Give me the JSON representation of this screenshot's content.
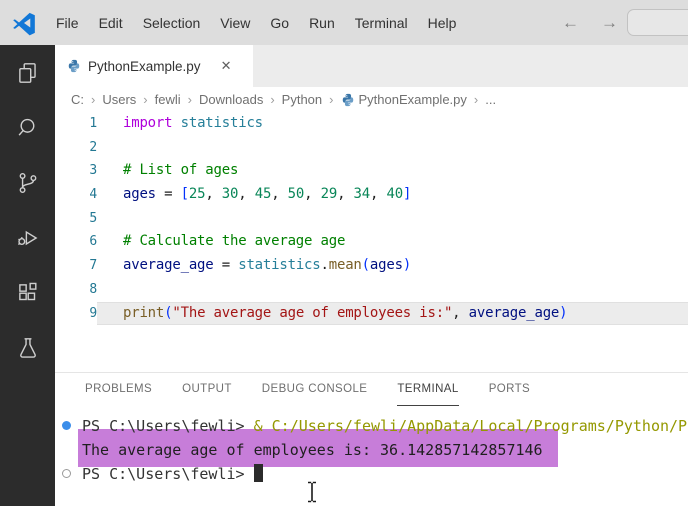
{
  "colors": {
    "titlebar_bg": "#dddddd",
    "activitybar_bg": "#2c2c2c",
    "tabstrip_bg": "#ececec",
    "editor_bg": "#ffffff",
    "terminal_selection": "#c77dd9",
    "terminal_command": "#949800",
    "command_success_dot": "#3b8eea",
    "keyword": "#af00db",
    "comment": "#008000",
    "string": "#a31515",
    "number": "#098658",
    "variable": "#001080",
    "function": "#795e26",
    "line_number": "#237893"
  },
  "titlebar": {
    "menus": [
      "File",
      "Edit",
      "Selection",
      "View",
      "Go",
      "Run",
      "Terminal",
      "Help"
    ],
    "back_glyph": "←",
    "forward_glyph": "→"
  },
  "activity_bar": {
    "icons": [
      "explorer",
      "search",
      "source-control",
      "run-and-debug",
      "extensions",
      "testing"
    ]
  },
  "editor": {
    "tab": {
      "label": "PythonExample.py",
      "close_glyph": "✕"
    },
    "breadcrumbs": [
      {
        "label": "C:"
      },
      {
        "label": "Users"
      },
      {
        "label": "fewli"
      },
      {
        "label": "Downloads"
      },
      {
        "label": "Python"
      },
      {
        "label": "PythonExample.py",
        "icon": "python"
      },
      {
        "label": "..."
      }
    ],
    "lines": [
      {
        "num": "1",
        "highlighted": false,
        "tokens": [
          {
            "t": "import",
            "c": "keyword"
          },
          {
            "t": " ",
            "c": "plain"
          },
          {
            "t": "statistics",
            "c": "module"
          }
        ]
      },
      {
        "num": "2",
        "highlighted": false,
        "tokens": []
      },
      {
        "num": "3",
        "highlighted": false,
        "tokens": [
          {
            "t": "# List of ages",
            "c": "comment"
          }
        ]
      },
      {
        "num": "4",
        "highlighted": false,
        "tokens": [
          {
            "t": "ages",
            "c": "var"
          },
          {
            "t": " = ",
            "c": "plain"
          },
          {
            "t": "[",
            "c": "bracket"
          },
          {
            "t": "25",
            "c": "num"
          },
          {
            "t": ", ",
            "c": "plain"
          },
          {
            "t": "30",
            "c": "num"
          },
          {
            "t": ", ",
            "c": "plain"
          },
          {
            "t": "45",
            "c": "num"
          },
          {
            "t": ", ",
            "c": "plain"
          },
          {
            "t": "50",
            "c": "num"
          },
          {
            "t": ", ",
            "c": "plain"
          },
          {
            "t": "29",
            "c": "num"
          },
          {
            "t": ", ",
            "c": "plain"
          },
          {
            "t": "34",
            "c": "num"
          },
          {
            "t": ", ",
            "c": "plain"
          },
          {
            "t": "40",
            "c": "num"
          },
          {
            "t": "]",
            "c": "bracket"
          }
        ]
      },
      {
        "num": "5",
        "highlighted": false,
        "tokens": []
      },
      {
        "num": "6",
        "highlighted": false,
        "tokens": [
          {
            "t": "# Calculate the average age",
            "c": "comment"
          }
        ]
      },
      {
        "num": "7",
        "highlighted": false,
        "tokens": [
          {
            "t": "average_age",
            "c": "var"
          },
          {
            "t": " = ",
            "c": "plain"
          },
          {
            "t": "statistics",
            "c": "module"
          },
          {
            "t": ".",
            "c": "plain"
          },
          {
            "t": "mean",
            "c": "func"
          },
          {
            "t": "(",
            "c": "bracket"
          },
          {
            "t": "ages",
            "c": "var"
          },
          {
            "t": ")",
            "c": "bracket"
          }
        ]
      },
      {
        "num": "8",
        "highlighted": false,
        "tokens": []
      },
      {
        "num": "9",
        "highlighted": true,
        "tokens": [
          {
            "t": "print",
            "c": "func"
          },
          {
            "t": "(",
            "c": "bracket"
          },
          {
            "t": "\"The average age of employees is:\"",
            "c": "string"
          },
          {
            "t": ", ",
            "c": "plain"
          },
          {
            "t": "average_age",
            "c": "var"
          },
          {
            "t": ")",
            "c": "bracket"
          }
        ]
      }
    ]
  },
  "panel": {
    "tabs": [
      {
        "label": "PROBLEMS",
        "active": false
      },
      {
        "label": "OUTPUT",
        "active": false
      },
      {
        "label": "DEBUG CONSOLE",
        "active": false
      },
      {
        "label": "TERMINAL",
        "active": true
      },
      {
        "label": "PORTS",
        "active": false
      }
    ]
  },
  "terminal": {
    "lines": [
      {
        "decoration": "success-dot",
        "selected": false,
        "cursor": false,
        "tokens": [
          {
            "t": "PS C:\\Users\\fewli> ",
            "c": "prompt"
          },
          {
            "t": "& C:/Users/fewli/AppData/Local/Programs/Python/P",
            "c": "command"
          }
        ]
      },
      {
        "decoration": "none",
        "selected": true,
        "cursor": false,
        "tokens": [
          {
            "t": "The average age of employees is: 36.142857142857146",
            "c": "output"
          }
        ]
      },
      {
        "decoration": "pending-circle",
        "selected": false,
        "cursor": true,
        "tokens": [
          {
            "t": "PS C:\\Users\\fewli> ",
            "c": "prompt"
          }
        ]
      }
    ]
  },
  "ui_state": {
    "mouse_cursor": "text-ibeam"
  }
}
